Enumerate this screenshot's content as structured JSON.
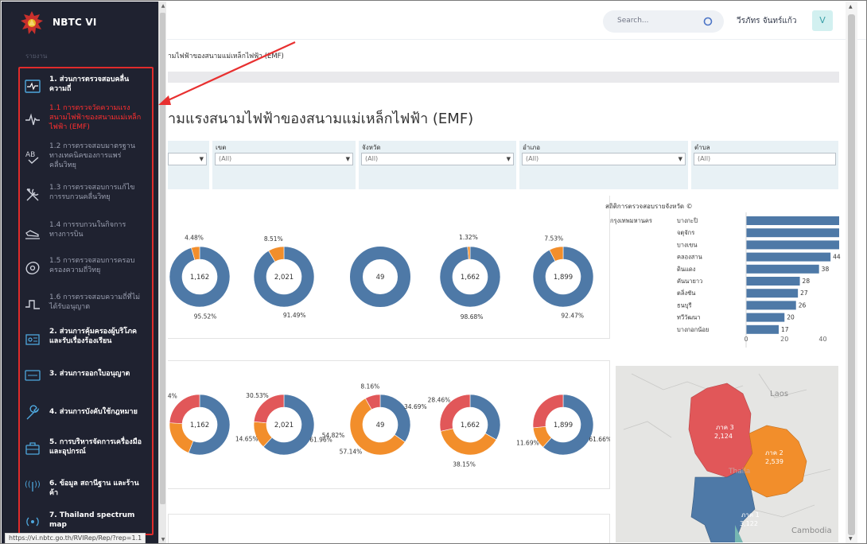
{
  "sidebar": {
    "brand": "NBTC VI",
    "section_label": "รายงาน",
    "items": [
      {
        "label": "1. ส่วนการตรวจสอบคลื่นความถี่",
        "kind": "main",
        "icon": "pulse-monitor-icon",
        "active": true
      },
      {
        "label": "1.1 การตรวจวัดความแรงสนามไฟฟ้าของสนามแม่เหล็กไฟฟ้า (EMF)",
        "kind": "sub",
        "icon": "heartbeat-icon",
        "active": true
      },
      {
        "label": "1.2 การตรวจสอบมาตรฐานทางเทคนิคของการแพร่คลื่นวิทยุ",
        "kind": "sub",
        "icon": "ab-check-icon"
      },
      {
        "label": "1.3 การตรวจสอบการแก้ไขการรบกวนคลื่นวิทยุ",
        "kind": "sub",
        "icon": "tools-icon"
      },
      {
        "label": "1.4 การรบกวนในกิจการทางการบิน",
        "kind": "sub",
        "icon": "plane-landing-icon"
      },
      {
        "label": "1.5 การตรวจสอบการครอบครองความถี่วิทยุ",
        "kind": "sub",
        "icon": "disc-icon"
      },
      {
        "label": "1.6 การตรวจสอบความถี่ที่ไม่ได้รับอนุญาต",
        "kind": "sub",
        "icon": "signal-step-icon"
      },
      {
        "label": "2. ส่วนการคุ้มครองผู้บริโภคและรับเรื่องร้องเรียน",
        "kind": "main",
        "icon": "consumer-icon"
      },
      {
        "label": "3. ส่วนการออกใบอนุญาต",
        "kind": "main",
        "icon": "license-icon"
      },
      {
        "label": "4. ส่วนการบังคับใช้กฎหมาย",
        "kind": "main",
        "icon": "wrench-icon"
      },
      {
        "label": "5. การบริหารจัดการเครื่องมือและอุปกรณ์",
        "kind": "main",
        "icon": "toolbox-icon"
      },
      {
        "label": "6. ข้อมูล สถานีฐาน และร้านค้า",
        "kind": "main",
        "icon": "antenna-icon"
      },
      {
        "label": "7. Thailand spectrum map",
        "kind": "main",
        "icon": "broadcast-icon"
      }
    ]
  },
  "topbar": {
    "search_placeholder": "Search...",
    "username": "วีรภัทร จันทร์แก้ว",
    "avatar_letter": "V"
  },
  "breadcrumb": "ามไฟฟ้าของสนามแม่เหล็กไฟฟ้า (EMF)",
  "page_title": "ามแรงสนามไฟฟ้าของสนามแม่เหล็กไฟฟ้า (EMF)",
  "filters": [
    {
      "label": "",
      "value": ""
    },
    {
      "label": "เขต",
      "value": "(All)"
    },
    {
      "label": "จังหวัด",
      "value": "(All)"
    },
    {
      "label": "อำเภอ",
      "value": "(All)"
    },
    {
      "label": "ตำบล",
      "value": "(All)"
    }
  ],
  "colors": {
    "sidebar_bg": "#1f2230",
    "blue": "#4e79a7",
    "orange": "#f28e2b",
    "red": "#e15759",
    "highlight_red": "#e02b2b"
  },
  "chart_data": [
    {
      "type": "pie",
      "subtype": "donut-row",
      "donuts": [
        {
          "center": "1,162",
          "slices": [
            {
              "label": "95.52%",
              "value": 95.52,
              "color": "blue"
            },
            {
              "label": "4.48%",
              "value": 4.48,
              "color": "orange"
            }
          ]
        },
        {
          "center": "2,021",
          "slices": [
            {
              "label": "91.49%",
              "value": 91.49,
              "color": "blue"
            },
            {
              "label": "8.51%",
              "value": 8.51,
              "color": "orange"
            }
          ]
        },
        {
          "center": "49",
          "slices": [
            {
              "label": "",
              "value": 100,
              "color": "blue"
            }
          ]
        },
        {
          "center": "1,662",
          "slices": [
            {
              "label": "98.68%",
              "value": 98.68,
              "color": "blue"
            },
            {
              "label": "1.32%",
              "value": 1.32,
              "color": "orange"
            }
          ]
        },
        {
          "center": "1,899",
          "slices": [
            {
              "label": "92.47%",
              "value": 92.47,
              "color": "blue"
            },
            {
              "label": "7.53%",
              "value": 7.53,
              "color": "orange"
            }
          ]
        }
      ]
    },
    {
      "type": "pie",
      "subtype": "donut-row",
      "donuts": [
        {
          "center": "1,162",
          "slices": [
            {
              "label": "",
              "value": 56,
              "color": "blue"
            },
            {
              "label": "",
              "value": 20,
              "color": "orange"
            },
            {
              "label": "4%",
              "value": 24,
              "color": "red"
            }
          ]
        },
        {
          "center": "2,021",
          "slices": [
            {
              "label": "61.96%",
              "value": 61.96,
              "color": "blue"
            },
            {
              "label": "14.65%",
              "value": 14.65,
              "color": "orange"
            },
            {
              "label": "30.53%",
              "value": 23.39,
              "color": "red"
            }
          ]
        },
        {
          "center": "49",
          "slices": [
            {
              "label": "34.69%",
              "value": 34.69,
              "color": "blue"
            },
            {
              "label": "57.14%",
              "value": 57.14,
              "color": "orange"
            },
            {
              "label": "8.16%",
              "value": 8.16,
              "color": "red"
            }
          ]
        },
        {
          "center": "1,662",
          "slices": [
            {
              "label": "",
              "value": 33.23,
              "color": "blue"
            },
            {
              "label": "38.15%",
              "value": 38.15,
              "color": "orange"
            },
            {
              "label": "28.46%",
              "value": 28.46,
              "color": "red"
            }
          ]
        },
        {
          "center": "1,899",
          "slices": [
            {
              "label": "61.66%",
              "value": 61.66,
              "color": "blue"
            },
            {
              "label": "11.69%",
              "value": 11.69,
              "color": "orange"
            },
            {
              "label": "",
              "value": 26.65,
              "color": "red"
            }
          ]
        }
      ],
      "extra_labels": [
        "54.82%"
      ]
    },
    {
      "type": "bar",
      "title": "สถิติการตรวจสอบรายจังหวัด ©",
      "group_label": "กรุงเทพมหานคร",
      "categories": [
        "บางกะปิ",
        "จตุจักร",
        "บางเขน",
        "คลองสาน",
        "ดินแดง",
        "คันนายาว",
        "ตลิ่งชัน",
        "ธนบุรี",
        "ทวีวัฒนา",
        "บางกอกน้อย"
      ],
      "values": [
        56,
        56,
        56,
        44,
        38,
        28,
        27,
        26,
        20,
        17
      ],
      "value_labels": [
        "",
        "",
        "",
        "44",
        "38",
        "28",
        "27",
        "26",
        "20",
        "17"
      ],
      "xticks": [
        "0",
        "20",
        "40"
      ],
      "xlim": [
        0,
        50
      ]
    }
  ],
  "map": {
    "regions": [
      {
        "name": "ภาค 3",
        "value": "2,124",
        "color": "red"
      },
      {
        "name": "ภาค 2",
        "value": "2,539",
        "color": "orange"
      },
      {
        "name": "ภาค 1",
        "value": "3,122",
        "color": "blue"
      }
    ],
    "place_labels": [
      "Laos",
      "Thaila",
      "Cambodia"
    ]
  },
  "status_url": "https://vi.nbtc.go.th/RVIRep/Rep/?rep=1.1"
}
